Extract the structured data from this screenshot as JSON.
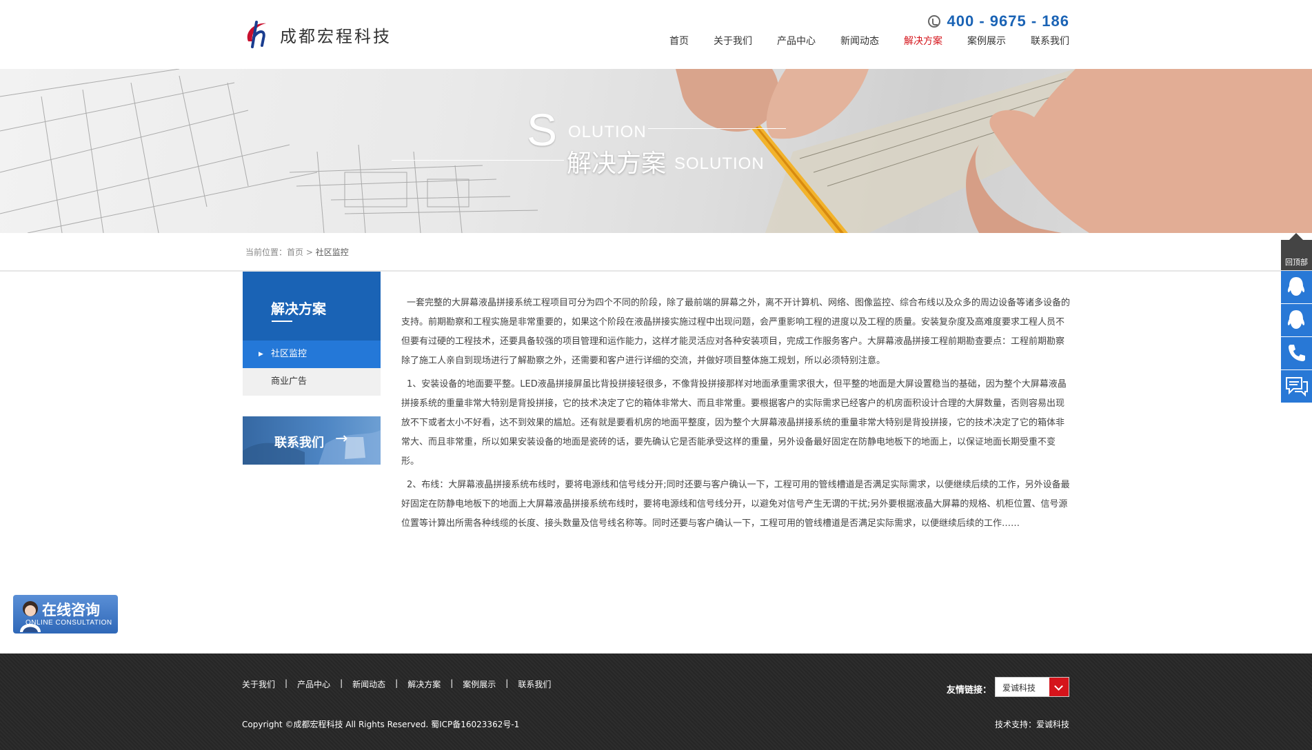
{
  "header": {
    "logo_text": "成都宏程科技",
    "hotline": "400 - 9675 - 186",
    "nav": [
      "首页",
      "关于我们",
      "产品中心",
      "新闻动态",
      "解决方案",
      "案例展示",
      "联系我们"
    ],
    "active_nav": "解决方案",
    "colors": {
      "brand_blue": "#1a63b5",
      "active_red": "#d5141b"
    }
  },
  "banner": {
    "big_letter": "S",
    "word": "OLUTION",
    "title_cn": "解决方案",
    "title_en": "SOLUTION"
  },
  "breadcrumb": {
    "prefix": "当前位置：",
    "home": "首页",
    "sep": " > ",
    "current": "社区监控"
  },
  "sidebar": {
    "title": "解决方案",
    "items": [
      "社区监控",
      "商业广告"
    ],
    "active_index": 0,
    "contact_label": "联系我们",
    "contact_arrow": "→"
  },
  "content": {
    "paragraphs": [
      "一套完整的大屏幕液晶拼接系统工程项目可分为四个不同的阶段，除了最前端的屏幕之外，离不开计算机、网络、图像监控、综合布线以及众多的周边设备等诸多设备的支持。前期勘察和工程实施是非常重要的，如果这个阶段在液晶拼接实施过程中出现问题，会严重影响工程的进度以及工程的质量。安装复杂度及高难度要求工程人员不但要有过硬的工程技术，还要具备较强的项目管理和运作能力，这样才能灵活应对各种安装项目，完成工作服务客户。大屏幕液晶拼接工程前期勘查要点：工程前期勘察除了施工人亲自到现场进行了解勘察之外，还需要和客户进行详细的交流，并做好项目整体施工规划，所以必须特别注意。",
      "1、安装设备的地面要平整。LED液晶拼接屏虽比背投拼接轻很多，不像背投拼接那样对地面承重需求很大，但平整的地面是大屏设置稳当的基础，因为整个大屏幕液晶拼接系统的重量非常大特别是背投拼接，它的技术决定了它的箱体非常大、而且非常重。要根据客户的实际需求已经客户的机房面积设计合理的大屏数量，否则容易出现放不下或者太小不好看，达不到效果的尴尬。还有就是要看机房的地面平整度，因为整个大屏幕液晶拼接系统的重量非常大特别是背投拼接，它的技术决定了它的箱体非常大、而且非常重，所以如果安装设备的地面是瓷砖的话，要先确认它是否能承受这样的重量，另外设备最好固定在防静电地板下的地面上，以保证地面长期受重不变形。",
      "2、布线：大屏幕液晶拼接系统布线时，要将电源线和信号线分开;同时还要与客户确认一下，工程可用的管线槽道是否满足实际需求，以便继续后续的工作，另外设备最好固定在防静电地板下的地面上大屏幕液晶拼接系统布线时，要将电源线和信号线分开，以避免对信号产生无谓的干扰;另外要根据液晶大屏幕的规格、机柜位置、信号源位置等计算出所需各种线缆的长度、接头数量及信号线名称等。同时还要与客户确认一下，工程可用的管线槽道是否满足实际需求，以便继续后续的工作……"
    ]
  },
  "consult": {
    "cn": "在线咨询",
    "en": "ONLINE CONSULTATION"
  },
  "right_float": {
    "top_label": "回顶部"
  },
  "footer": {
    "links": [
      "关于我们",
      "产品中心",
      "新闻动态",
      "解决方案",
      "案例展示",
      "联系我们"
    ],
    "link_sep": "|",
    "friend_label": "友情链接：",
    "friend_selected": "爱诚科技",
    "copyright": "Copyright ©成都宏程科技 All Rights Reserved. 蜀ICP备16023362号-1",
    "tech_support": "技术支持：爱诚科技"
  }
}
